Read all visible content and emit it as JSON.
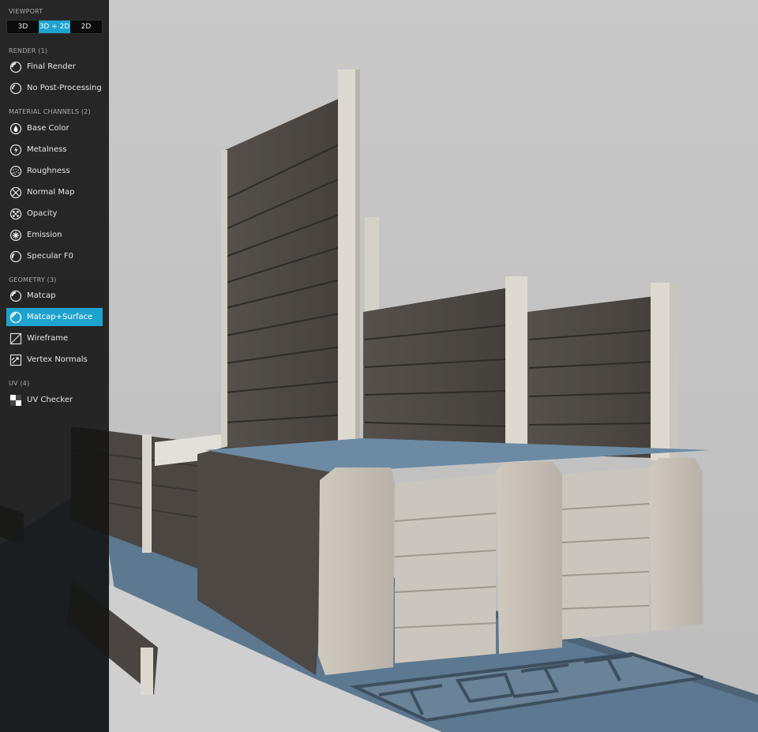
{
  "viewport": {
    "title": "VIEWPORT",
    "options": [
      "3D",
      "3D + 2D",
      "2D"
    ],
    "selected": "3D + 2D"
  },
  "render": {
    "title": "RENDER (1)",
    "items": [
      {
        "label": "Final Render",
        "icon": "final-render-icon"
      },
      {
        "label": "No Post-Processing",
        "icon": "no-post-processing-icon"
      }
    ]
  },
  "material_channels": {
    "title": "MATERIAL CHANNELS (2)",
    "items": [
      {
        "label": "Base Color",
        "icon": "base-color-icon"
      },
      {
        "label": "Metalness",
        "icon": "metalness-icon"
      },
      {
        "label": "Roughness",
        "icon": "roughness-icon"
      },
      {
        "label": "Normal Map",
        "icon": "normal-map-icon"
      },
      {
        "label": "Opacity",
        "icon": "opacity-icon"
      },
      {
        "label": "Emission",
        "icon": "emission-icon"
      },
      {
        "label": "Specular F0",
        "icon": "specular-icon"
      }
    ]
  },
  "geometry": {
    "title": "GEOMETRY (3)",
    "items": [
      {
        "label": "Matcap",
        "icon": "matcap-icon"
      },
      {
        "label": "Matcap+Surface",
        "icon": "matcap-surface-icon",
        "active": true
      },
      {
        "label": "Wireframe",
        "icon": "wireframe-icon"
      },
      {
        "label": "Vertex Normals",
        "icon": "vertex-normals-icon"
      }
    ]
  },
  "uv": {
    "title": "UV (4)",
    "items": [
      {
        "label": "UV Checker",
        "icon": "uv-checker-icon"
      }
    ]
  },
  "colors": {
    "accent": "#1ea3cf",
    "panel_bg": "#141414",
    "scene_bg": "#c4c4c4",
    "base_plate": "#5f7a91",
    "panel_wood": "#4a4541",
    "stone": "#c8c2b9"
  }
}
